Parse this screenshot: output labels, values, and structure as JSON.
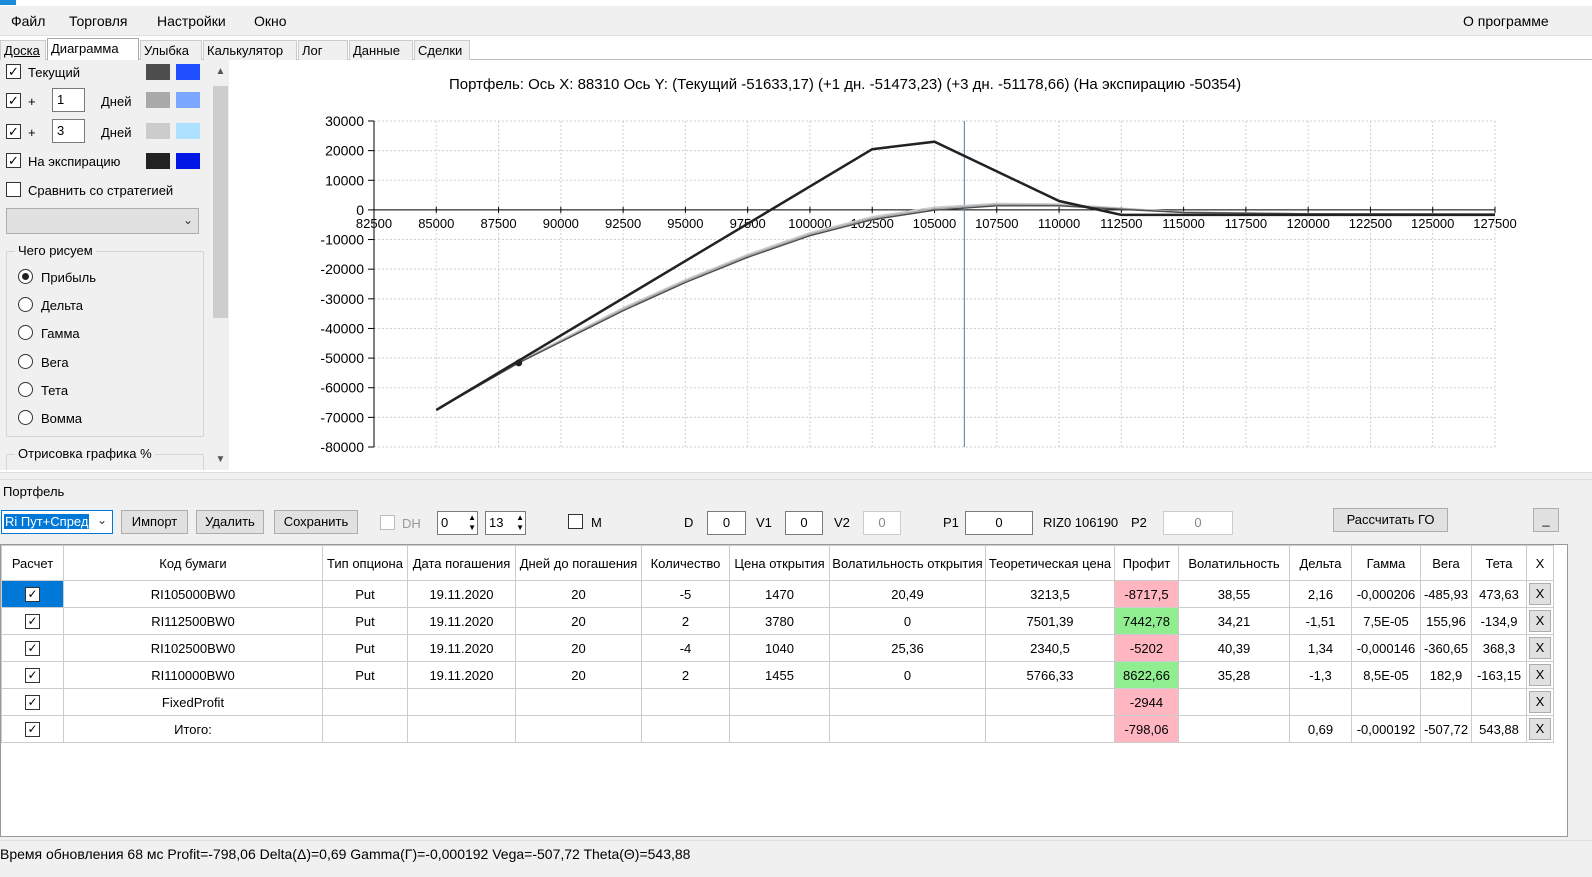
{
  "menu": {
    "file": "Файл",
    "trade": "Торговля",
    "settings": "Настройки",
    "window": "Окно",
    "about": "О программе"
  },
  "tabs": [
    "Доска",
    "Диаграмма",
    "Улыбка",
    "Калькулятор",
    "Лог",
    "Данные",
    "Сделки"
  ],
  "left": {
    "current": "Текущий",
    "plus": "+",
    "days": "Дней",
    "day1": "1",
    "day3": "3",
    "expiration": "На экспирацию",
    "compare": "Сравнить со стратегией",
    "whatDraw": "Чего рисуем",
    "radios": [
      "Прибыль",
      "Дельта",
      "Гамма",
      "Вега",
      "Тета",
      "Вомма"
    ],
    "drawPct": "Отрисовка графика %"
  },
  "colors": {
    "current_gray": "#4d4d4d",
    "current_blue": "#1f4fff",
    "d1_gray": "#a9a9a9",
    "d1_blue": "#7aa7ff",
    "d3_gray": "#cccccc",
    "d3_blue": "#aee0ff",
    "exp_gray": "#222222",
    "exp_blue": "#0017e6"
  },
  "chart": {
    "title": "Портфель: Ось X: 88310 Ось Y:  (Текущий -51633,17)  (+1 дн. -51473,23)  (+3 дн. -51178,66)  (На экспирацию -50354)",
    "yticks": [
      "30000",
      "20000",
      "10000",
      "0",
      "-10000",
      "-20000",
      "-30000",
      "-40000",
      "-50000",
      "-60000",
      "-70000",
      "-80000"
    ],
    "xticks": [
      "82500",
      "85000",
      "87500",
      "90000",
      "92500",
      "95000",
      "97500",
      "100000",
      "102500",
      "105000",
      "107500",
      "110000",
      "112500",
      "115000",
      "117500",
      "120000",
      "122500",
      "125000",
      "127500"
    ]
  },
  "chart_data": {
    "type": "line",
    "ylim": [
      -80000,
      30000
    ],
    "xlim": [
      82500,
      127500
    ],
    "cursor_x": 106200,
    "marker": {
      "x": 88310,
      "y": -51633
    },
    "series": [
      {
        "x": [
          85000,
          102500,
          105000,
          110000,
          112500,
          127500
        ],
        "y": [
          -67500,
          20500,
          23000,
          3000,
          -1700,
          -1700
        ]
      },
      {
        "x": [
          85000,
          88310,
          92500,
          95000,
          97500,
          100000,
          102500,
          105000,
          107500,
          110000,
          112500,
          115000,
          120000,
          127500
        ],
        "y": [
          -67500,
          -51633,
          -34000,
          -24500,
          -16000,
          -8700,
          -3300,
          -100,
          1400,
          1400,
          200,
          -900,
          -1300,
          -1400
        ]
      },
      {
        "x": [
          85000,
          88310,
          92500,
          95000,
          97500,
          100000,
          102500,
          105000,
          107500,
          110000,
          112500,
          115000,
          120000,
          127500
        ],
        "y": [
          -67500,
          -51473,
          -33500,
          -24000,
          -15500,
          -8200,
          -2800,
          400,
          1800,
          1700,
          400,
          -800,
          -1300,
          -1400
        ]
      },
      {
        "x": [
          85000,
          88310,
          92500,
          95000,
          97500,
          100000,
          102500,
          105000,
          107500,
          110000,
          112500,
          115000,
          120000,
          127500
        ],
        "y": [
          -67500,
          -51178,
          -33000,
          -23500,
          -15000,
          -7700,
          -2300,
          900,
          2200,
          2000,
          600,
          -700,
          -1300,
          -1400
        ]
      }
    ]
  },
  "portfolio": {
    "label": "Портфель",
    "strategy": "Ri Пут+Спред",
    "import": "Импорт",
    "delete": "Удалить",
    "save": "Сохранить",
    "dh": "DH",
    "dhv1": "0",
    "dhv2": "13",
    "m": "M",
    "d": "D",
    "dv": "0",
    "v1": "V1",
    "v1v": "0",
    "v2": "V2",
    "v2v": "0",
    "p1": "P1",
    "p1v": "0",
    "riz": "RIZ0 106190",
    "p2": "P2",
    "p2v": "0",
    "calcGo": "Рассчитать ГО",
    "minimize": "_"
  },
  "table": {
    "headers": [
      "Расчет",
      "Код бумаги",
      "Тип опциона",
      "Дата погашения",
      "Дней до погашения",
      "Количество",
      "Цена открытия",
      "Волатильность открытия",
      "Теоретическая цена",
      "Профит",
      "Волатильность",
      "Дельта",
      "Гамма",
      "Вега",
      "Тета",
      "X"
    ],
    "rows": [
      {
        "code": "RI105000BW0",
        "type": "Put",
        "date": "19.11.2020",
        "days": "20",
        "qty": "-5",
        "price": "1470",
        "vol_open": "20,49",
        "theo": "3213,5",
        "profit": "-8717,5",
        "profit_cls": "red",
        "vol": "38,55",
        "delta": "2,16",
        "gamma": "-0,000206",
        "vega": "-485,93",
        "theta": "473,63",
        "x": "X"
      },
      {
        "code": "RI112500BW0",
        "type": "Put",
        "date": "19.11.2020",
        "days": "20",
        "qty": "2",
        "price": "3780",
        "vol_open": "0",
        "theo": "7501,39",
        "profit": "7442,78",
        "profit_cls": "green",
        "vol": "34,21",
        "delta": "-1,51",
        "gamma": "7,5E-05",
        "vega": "155,96",
        "theta": "-134,9",
        "x": "X"
      },
      {
        "code": "RI102500BW0",
        "type": "Put",
        "date": "19.11.2020",
        "days": "20",
        "qty": "-4",
        "price": "1040",
        "vol_open": "25,36",
        "theo": "2340,5",
        "profit": "-5202",
        "profit_cls": "red",
        "vol": "40,39",
        "delta": "1,34",
        "gamma": "-0,000146",
        "vega": "-360,65",
        "theta": "368,3",
        "x": "X"
      },
      {
        "code": "RI110000BW0",
        "type": "Put",
        "date": "19.11.2020",
        "days": "20",
        "qty": "2",
        "price": "1455",
        "vol_open": "0",
        "theo": "5766,33",
        "profit": "8622,66",
        "profit_cls": "green",
        "vol": "35,28",
        "delta": "-1,3",
        "gamma": "8,5E-05",
        "vega": "182,9",
        "theta": "-163,15",
        "x": "X"
      },
      {
        "code": "FixedProfit",
        "type": "",
        "date": "",
        "days": "",
        "qty": "",
        "price": "",
        "vol_open": "",
        "theo": "",
        "profit": "-2944",
        "profit_cls": "red",
        "vol": "",
        "delta": "",
        "gamma": "",
        "vega": "",
        "theta": "",
        "x": "X"
      },
      {
        "code": "Итого:",
        "type": "",
        "date": "",
        "days": "",
        "qty": "",
        "price": "",
        "vol_open": "",
        "theo": "",
        "profit": "-798,06",
        "profit_cls": "red",
        "vol": "",
        "delta": "0,69",
        "gamma": "-0,000192",
        "vega": "-507,72",
        "theta": "543,88",
        "x": "X"
      }
    ]
  },
  "status": "Время обновления 68 мс  Profit=-798,06 Delta(Δ)=0,69 Gamma(Γ)=-0,000192 Vega=-507,72 Theta(Θ)=543,88"
}
